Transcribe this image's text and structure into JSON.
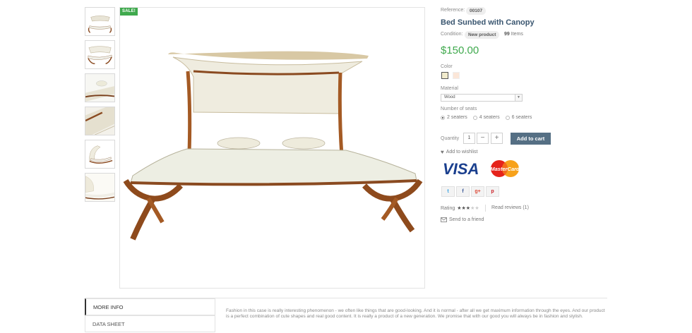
{
  "badge": {
    "sale": "SALE!"
  },
  "reference": {
    "label": "Reference:",
    "value": "00107"
  },
  "product": {
    "title": "Bed Sunbed with Canopy",
    "condition_label": "Condition:",
    "condition_value": "New product",
    "items_count": "99",
    "items_label": "Items",
    "price": "$150.00"
  },
  "options": {
    "color_label": "Color",
    "colors": [
      "#f1ebcc",
      "#fbe6d8"
    ],
    "material_label": "Material",
    "material_value": "Wood",
    "seats_label": "Number of seats",
    "seats": [
      "2 seaters",
      "4 seaters",
      "6 seaters"
    ],
    "seats_selected": "2 seaters"
  },
  "purchase": {
    "quantity_label": "Quantity",
    "quantity_value": "1",
    "minus": "−",
    "plus": "+",
    "add_to_cart": "Add to cart",
    "wishlist": "Add to wishlist"
  },
  "payments": {
    "visa": "VISA",
    "mastercard": "MasterCard"
  },
  "share": {
    "twitter": "t",
    "facebook": "f",
    "google": "g+",
    "pinterest": "p"
  },
  "rating": {
    "label": "Rating",
    "stars": 3,
    "max": 5,
    "reviews": "Read reviews (1)"
  },
  "send_friend": "Send to a friend",
  "tabs": {
    "more_info": "MORE INFO",
    "data_sheet": "DATA SHEET"
  },
  "description": "Fashion in this case is really interesting phenomenon - we often like things that are good-looking. And it is normal - after all we get maximum information through the eyes. And our product is a perfect combination of cute shapes and real good content. It is really a product of a new generation. We promise that with our good you will always be in fashion and stylish.",
  "colors": {
    "accent_green": "#3fa94d",
    "button_slate": "#556f84",
    "title_blue": "#3a5670"
  }
}
